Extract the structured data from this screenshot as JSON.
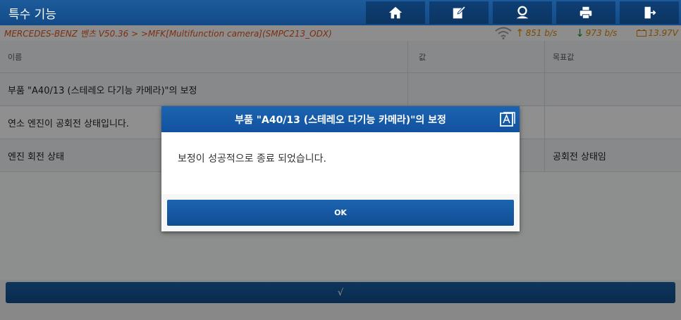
{
  "header": {
    "title": "특수 기능",
    "buttons": [
      {
        "name": "home-button",
        "icon": "home-icon"
      },
      {
        "name": "report-button",
        "icon": "edit-icon"
      },
      {
        "name": "user-button",
        "icon": "user-icon"
      },
      {
        "name": "print-button",
        "icon": "print-icon"
      },
      {
        "name": "exit-button",
        "icon": "exit-icon"
      }
    ]
  },
  "status": {
    "path": "MERCEDES-BENZ 벤츠 V50.36 > >MFK[Multifunction camera](SMPC213_ODX)",
    "upload_rate": "851 b/s",
    "download_rate": "973 b/s",
    "voltage": "13.97V"
  },
  "table": {
    "headers": [
      "이름",
      "값",
      "목표값"
    ],
    "rows": [
      [
        "부품 \"A40/13 (스테레오 다기능 카메라)\"의 보정",
        "",
        ""
      ],
      [
        "연소 엔진이 공회전 상태입니다.",
        "",
        ""
      ],
      [
        "엔진 회전 상태",
        "",
        "공회전 상태임"
      ]
    ]
  },
  "bottom": {
    "confirm_label": "√"
  },
  "dialog": {
    "title": "부품 \"A40/13 (스테레오 다기능 카메라)\"의 보정",
    "message": "보정이 성공적으로 종료 되었습니다.",
    "ok_label": "OK"
  },
  "colors": {
    "accent": "#124a86",
    "status_path": "#d9501e",
    "status_rate": "#d68200",
    "download_arrow": "#1e8d2a"
  }
}
